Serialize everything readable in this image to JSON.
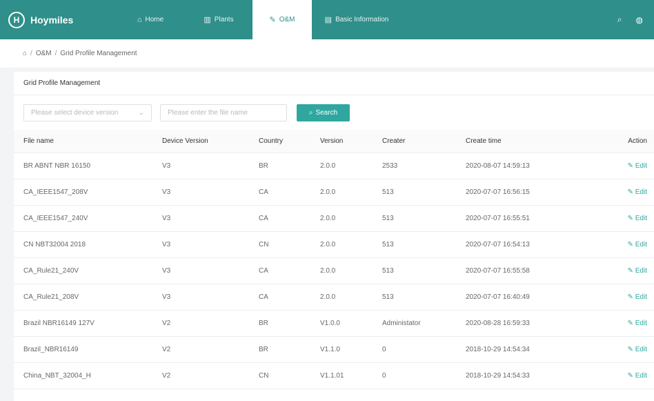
{
  "brand": {
    "logo_letter": "H",
    "name": "Hoymiles"
  },
  "nav": {
    "home": "Home",
    "plants": "Plants",
    "oam": "O&M",
    "basic": "Basic Information"
  },
  "breadcrumb": {
    "item1": "O&M",
    "separator": "/",
    "item2": "Grid Profile Management"
  },
  "card_title": "Grid Profile Management",
  "filters": {
    "device_version_placeholder": "Please select device version",
    "file_name_placeholder": "Please enter the file name",
    "search_label": "Search"
  },
  "table": {
    "headers": {
      "file_name": "File name",
      "device_version": "Device Version",
      "country": "Country",
      "version": "Version",
      "creater": "Creater",
      "create_time": "Create time",
      "action": "Action"
    },
    "edit_label": "Edit",
    "rows": [
      {
        "file": "BR ABNT NBR 16150",
        "device": "V3",
        "country": "BR",
        "version": "2.0.0",
        "creater": "2533",
        "time": "2020-08-07 14:59:13"
      },
      {
        "file": "CA_IEEE1547_208V",
        "device": "V3",
        "country": "CA",
        "version": "2.0.0",
        "creater": "513",
        "time": "2020-07-07 16:56:15"
      },
      {
        "file": "CA_IEEE1547_240V",
        "device": "V3",
        "country": "CA",
        "version": "2.0.0",
        "creater": "513",
        "time": "2020-07-07 16:55:51"
      },
      {
        "file": "CN NBT32004 2018",
        "device": "V3",
        "country": "CN",
        "version": "2.0.0",
        "creater": "513",
        "time": "2020-07-07 16:54:13"
      },
      {
        "file": "CA_Rule21_240V",
        "device": "V3",
        "country": "CA",
        "version": "2.0.0",
        "creater": "513",
        "time": "2020-07-07 16:55:58"
      },
      {
        "file": "CA_Rule21_208V",
        "device": "V3",
        "country": "CA",
        "version": "2.0.0",
        "creater": "513",
        "time": "2020-07-07 16:40:49"
      },
      {
        "file": "Brazil NBR16149 127V",
        "device": "V2",
        "country": "BR",
        "version": "V1.0.0",
        "creater": "Administator",
        "time": "2020-08-28 16:59:33"
      },
      {
        "file": "Brazil_NBR16149",
        "device": "V2",
        "country": "BR",
        "version": "V1.1.0",
        "creater": "0",
        "time": "2018-10-29 14:54:34"
      },
      {
        "file": "China_NBT_32004_H",
        "device": "V2",
        "country": "CN",
        "version": "V1.1.01",
        "creater": "0",
        "time": "2018-10-29 14:54:33"
      }
    ]
  },
  "icons": {
    "home": "home-icon",
    "plants": "plants-icon",
    "oam": "wrench-icon",
    "basic": "document-icon",
    "search": "search-icon",
    "globe": "globe-icon",
    "edit": "pencil-icon",
    "dropdown": "chevron-down-icon"
  },
  "colors": {
    "brand_teal": "#2f8f8a",
    "accent": "#2fa7a0"
  }
}
